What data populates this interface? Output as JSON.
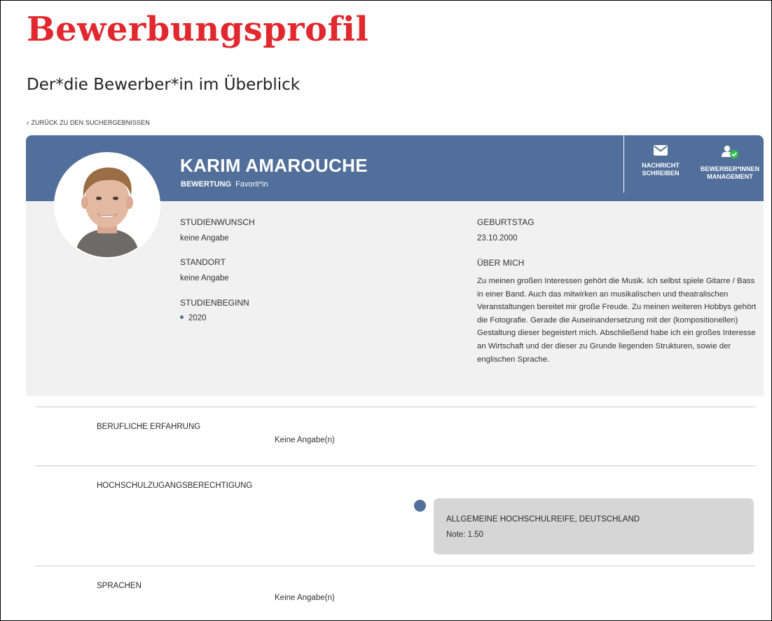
{
  "page": {
    "title": "Bewerbungsprofil",
    "subtitle": "Der*die Bewerber*in im Überblick",
    "back_link": "ZURÜCK ZU DEN SUCHERGEBNISSEN"
  },
  "profile": {
    "name": "KARIM AMAROUCHE",
    "rating_label": "BEWERTUNG",
    "rating_value": "Favorit*in",
    "avatar_icon": "user-photo"
  },
  "actions": {
    "message_line1": "NACHRICHT",
    "message_line2": "SCHREIBEN",
    "message_icon": "envelope-icon",
    "management_line1": "BEWERBER*INNEN",
    "management_line2": "MANAGEMENT",
    "management_icon": "user-check-icon"
  },
  "details": {
    "studienwunsch_label": "STUDIENWUNSCH",
    "studienwunsch_value": "keine Angabe",
    "standort_label": "STANDORT",
    "standort_value": "keine Angabe",
    "studienbeginn_label": "STUDIENBEGINN",
    "studienbeginn_value": "2020",
    "geburtstag_label": "GEBURTSTAG",
    "geburtstag_value": "23.10.2000",
    "ueber_mich_label": "ÜBER MICH",
    "ueber_mich_text": "Zu meinen großen Interessen gehört die Musik. Ich selbst spiele Gitarre / Bass in einer Band. Auch das mitwirken an musikalischen und theatralischen Veranstaltungen bereitet mir große Freude. Zu meinen weiteren Hobbys gehört die Fotografie. Gerade die Auseinandersetzung mit der (kompositionellen) Gestaltung dieser begeistert mich. Abschließend habe ich ein großes Interesse an Wirtschaft und der dieser zu Grunde liegenden Strukturen, sowie der englischen Sprache."
  },
  "sections": {
    "experience_title": "BERUFLICHE ERFAHRUNG",
    "experience_value": "Keine Angabe(n)",
    "hzb_title": "HOCHSCHULZUGANGSBERECHTIGUNG",
    "hzb_entry_title": "ALLGEMEINE HOCHSCHULREIFE, DEUTSCHLAND",
    "hzb_entry_note": "Note: 1.50",
    "languages_title": "SPRACHEN",
    "languages_value": "Keine Angabe(n)"
  },
  "colors": {
    "title_red": "#e0282e",
    "header_blue": "#516f9a",
    "card_bg": "#f1f1f1",
    "edu_box_bg": "#d6d6d6",
    "check_green": "#2fbf4a"
  }
}
